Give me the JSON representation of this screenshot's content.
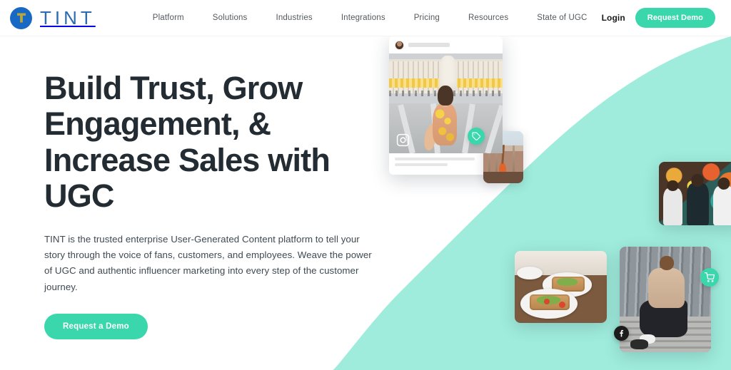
{
  "header": {
    "logo": {
      "icon": "tint-logo-icon",
      "wordmark": "TINT",
      "mark_color": "#1769c4",
      "glyph_color": "#b5a642"
    },
    "nav": [
      {
        "label": "Platform"
      },
      {
        "label": "Solutions"
      },
      {
        "label": "Industries"
      },
      {
        "label": "Integrations"
      },
      {
        "label": "Pricing"
      },
      {
        "label": "Resources"
      },
      {
        "label": "State of UGC"
      }
    ],
    "login_label": "Login",
    "demo_button_label": "Request Demo"
  },
  "hero": {
    "title": "Build Trust, Grow Engagement, & Increase Sales with UGC",
    "subtitle": "TINT is the trusted enterprise User-Generated Content platform to tell your story through the voice of fans, customers, and employees. Weave the power of UGC and authentic influencer marketing into every step of the customer journey.",
    "cta_label": "Request a Demo"
  },
  "collage": {
    "instagram_card": {
      "caption_placeholder": "",
      "badge_icon": "instagram-icon",
      "avatar": "user-avatar",
      "photo_alt": "Woman in yellow floral dress walking in Venice piazza"
    },
    "cards": [
      {
        "name": "guitar-card",
        "photo_alt": "Acoustic guitar on a dusty street",
        "badge_icon": "tag-icon"
      },
      {
        "name": "mural-card",
        "photo_alt": "Three friends in front of a colorful mural",
        "badge_icon": null
      },
      {
        "name": "food-card",
        "photo_alt": "Avocado toast plates on a table",
        "badge_icon": null
      },
      {
        "name": "street-style-card",
        "photo_alt": "Man in beige turtleneck sitting on steps",
        "badge_icon": "facebook-icon",
        "badge_icon_2": "shopping-cart-icon"
      }
    ]
  },
  "colors": {
    "accent_teal": "#3ad7ad",
    "swoosh_mint": "#9fecdc",
    "brand_blue": "#1769c4",
    "heading": "#242c33",
    "body_text": "#3f4a52"
  }
}
